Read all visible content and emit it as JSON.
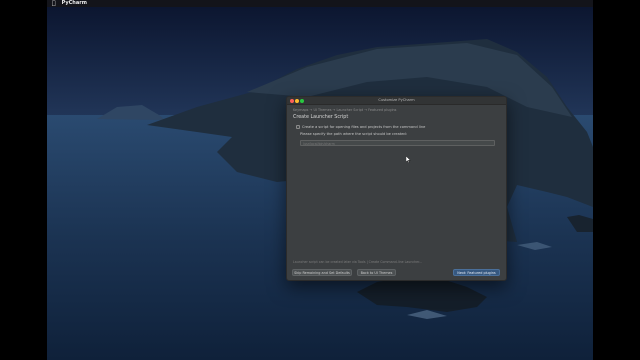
{
  "menubar": {
    "app_name": "PyCharm"
  },
  "dialog": {
    "window_title": "Customize PyCharm",
    "breadcrumb": "Keymaps → UI Themes → Launcher Script → Featured plugins",
    "heading": "Create Launcher Script",
    "checkbox_label": "Create a script for opening files and projects from the command line",
    "path_note": "Please specify the path where the script should be created:",
    "path_placeholder": "/usr/local/bin/charm",
    "footnote": "Launcher script can be created later via Tools | Create Command-line Launcher...",
    "buttons": {
      "skip": "Skip Remaining and Set Defaults",
      "back": "Back to UI Themes",
      "next": "Next: Featured plugins"
    }
  },
  "colors": {
    "dialog_bg": "#3c3f41",
    "primary_button": "#365880",
    "ocean": "#1d3556"
  }
}
